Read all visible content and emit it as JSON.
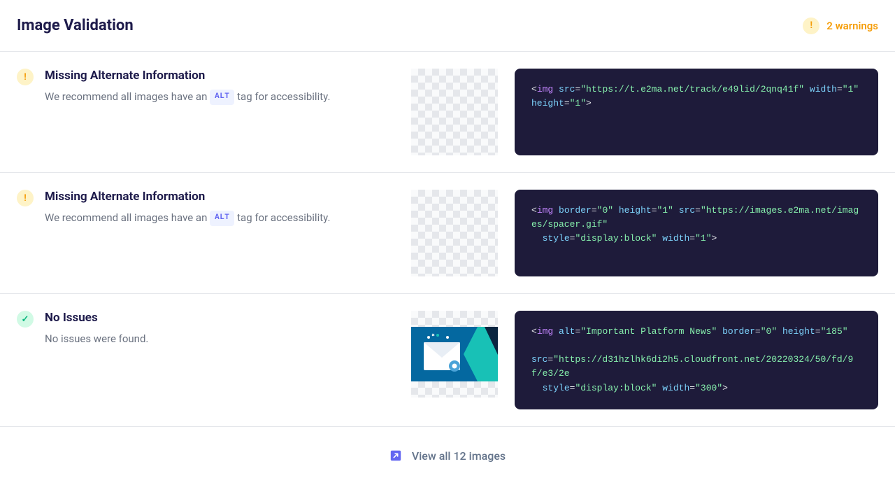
{
  "header": {
    "title": "Image Validation",
    "warnings_count_text": "2 warnings"
  },
  "items": [
    {
      "status": "warning",
      "title": "Missing Alternate Information",
      "description_prefix": "We recommend all images have an ",
      "description_badge": "ALT",
      "description_suffix": " tag for accessibility.",
      "has_image_content": false,
      "code_tokens": [
        {
          "t": "punc",
          "v": "<"
        },
        {
          "t": "tag",
          "v": "img"
        },
        {
          "t": "text",
          "v": " "
        },
        {
          "t": "attr",
          "v": "src"
        },
        {
          "t": "eq",
          "v": "="
        },
        {
          "t": "str",
          "v": "\"https://t.e2ma.net/track/e49lid/2qnq41f\""
        },
        {
          "t": "text",
          "v": " "
        },
        {
          "t": "attr",
          "v": "width"
        },
        {
          "t": "eq",
          "v": "="
        },
        {
          "t": "str",
          "v": "\"1\""
        },
        {
          "t": "text",
          "v": " "
        },
        {
          "t": "attr",
          "v": "height"
        },
        {
          "t": "eq",
          "v": "="
        },
        {
          "t": "str",
          "v": "\"1\""
        },
        {
          "t": "punc",
          "v": ">"
        }
      ]
    },
    {
      "status": "warning",
      "title": "Missing Alternate Information",
      "description_prefix": "We recommend all images have an ",
      "description_badge": "ALT",
      "description_suffix": " tag for accessibility.",
      "has_image_content": false,
      "code_tokens": [
        {
          "t": "punc",
          "v": "<"
        },
        {
          "t": "tag",
          "v": "img"
        },
        {
          "t": "text",
          "v": " "
        },
        {
          "t": "attr",
          "v": "border"
        },
        {
          "t": "eq",
          "v": "="
        },
        {
          "t": "str",
          "v": "\"0\""
        },
        {
          "t": "text",
          "v": " "
        },
        {
          "t": "attr",
          "v": "height"
        },
        {
          "t": "eq",
          "v": "="
        },
        {
          "t": "str",
          "v": "\"1\""
        },
        {
          "t": "text",
          "v": " "
        },
        {
          "t": "attr",
          "v": "src"
        },
        {
          "t": "eq",
          "v": "="
        },
        {
          "t": "str",
          "v": "\"https://images.e2ma.net/images/spacer.gif\""
        },
        {
          "t": "text",
          "v": "\n  "
        },
        {
          "t": "attr",
          "v": "style"
        },
        {
          "t": "eq",
          "v": "="
        },
        {
          "t": "str",
          "v": "\"display:block\""
        },
        {
          "t": "text",
          "v": " "
        },
        {
          "t": "attr",
          "v": "width"
        },
        {
          "t": "eq",
          "v": "="
        },
        {
          "t": "str",
          "v": "\"1\""
        },
        {
          "t": "punc",
          "v": ">"
        }
      ]
    },
    {
      "status": "success",
      "title": "No Issues",
      "description_prefix": "No issues were found.",
      "description_badge": "",
      "description_suffix": "",
      "has_image_content": true,
      "code_tokens": [
        {
          "t": "punc",
          "v": "<"
        },
        {
          "t": "tag",
          "v": "img"
        },
        {
          "t": "text",
          "v": " "
        },
        {
          "t": "attr",
          "v": "alt"
        },
        {
          "t": "eq",
          "v": "="
        },
        {
          "t": "str",
          "v": "\"Important Platform News\""
        },
        {
          "t": "text",
          "v": " "
        },
        {
          "t": "attr",
          "v": "border"
        },
        {
          "t": "eq",
          "v": "="
        },
        {
          "t": "str",
          "v": "\"0\""
        },
        {
          "t": "text",
          "v": " "
        },
        {
          "t": "attr",
          "v": "height"
        },
        {
          "t": "eq",
          "v": "="
        },
        {
          "t": "str",
          "v": "\"185\""
        },
        {
          "t": "text",
          "v": "\n\n"
        },
        {
          "t": "attr",
          "v": "src"
        },
        {
          "t": "eq",
          "v": "="
        },
        {
          "t": "str",
          "v": "\"https://d31hzlhk6di2h5.cloudfront.net/20220324/50/fd/9f/e3/2e"
        },
        {
          "t": "text",
          "v": "\n  "
        },
        {
          "t": "attr",
          "v": "style"
        },
        {
          "t": "eq",
          "v": "="
        },
        {
          "t": "str",
          "v": "\"display:block\""
        },
        {
          "t": "text",
          "v": " "
        },
        {
          "t": "attr",
          "v": "width"
        },
        {
          "t": "eq",
          "v": "="
        },
        {
          "t": "str",
          "v": "\"300\""
        },
        {
          "t": "punc",
          "v": ">"
        }
      ]
    }
  ],
  "footer": {
    "view_all_text": "View all 12 images"
  }
}
